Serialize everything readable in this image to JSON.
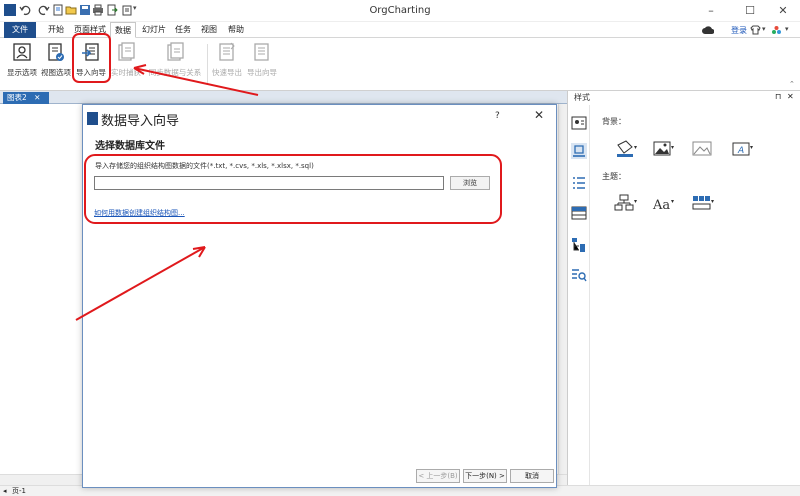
{
  "window": {
    "title": "OrgCharting",
    "login": "登录",
    "minimize": "–",
    "maximize": "☐",
    "close": "✕"
  },
  "menu": {
    "tabs": [
      "文件",
      "开始",
      "页面样式",
      "数据",
      "幻灯片",
      "任务",
      "视图",
      "帮助"
    ]
  },
  "ribbon": {
    "buttons": [
      {
        "label": "显示选项",
        "icon": "display-options-icon"
      },
      {
        "label": "视图选项",
        "icon": "view-options-icon"
      },
      {
        "label": "导入向导",
        "icon": "import-wizard-icon"
      },
      {
        "label": "实时捕获",
        "icon": "live-capture-icon"
      },
      {
        "label": "同步数据与关系",
        "icon": "sync-data-icon"
      },
      {
        "label": "快速导出",
        "icon": "quick-export-icon"
      },
      {
        "label": "导出向导",
        "icon": "export-wizard-icon"
      }
    ]
  },
  "document": {
    "tab_label": "图表2",
    "tab_close": "✕"
  },
  "status": {
    "page": "页-1"
  },
  "style_panel": {
    "title": "样式",
    "pin": "⊓",
    "close": "✕",
    "background_label": "背景：",
    "theme_label": "主题："
  },
  "dialog": {
    "title": "数据导入向导",
    "help": "?",
    "close": "✕",
    "subtitle": "选择数据库文件",
    "description": "导入存储您的组织结构图数据的文件(*.txt, *.cvs, *.xls, *.xlsx, *.sql)",
    "file_value": "",
    "browse": "浏览",
    "help_link": "如何用数据创建组织结构图...",
    "prev": "< 上一步(B)",
    "next": "下一步(N) >",
    "cancel": "取消"
  },
  "colors": {
    "accent": "#1f4e8c",
    "annotation": "#e0191c",
    "link": "#1a55b8"
  }
}
